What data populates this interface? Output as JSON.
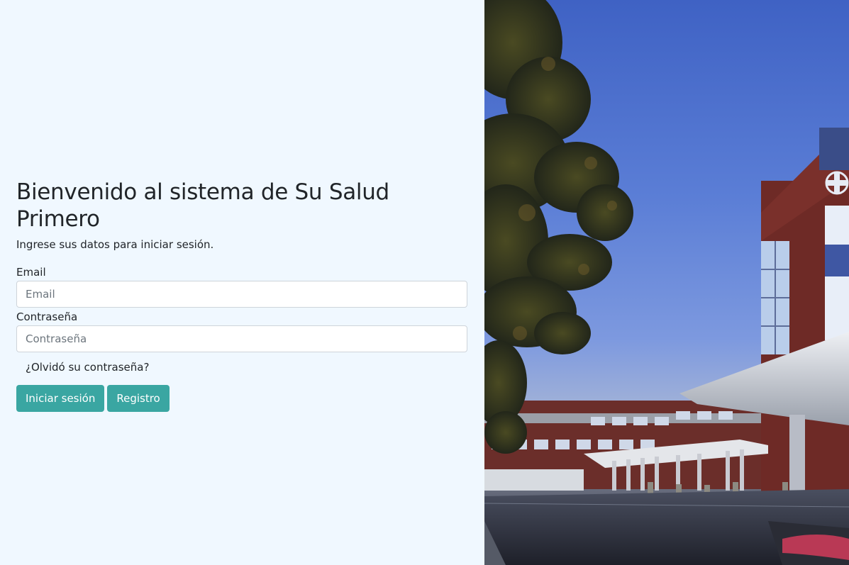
{
  "login": {
    "title": "Bienvenido al sistema de Su Salud Primero",
    "subtitle": "Ingrese sus datos para iniciar sesión.",
    "email_label": "Email",
    "email_placeholder": "Email",
    "email_value": "",
    "password_label": "Contraseña",
    "password_placeholder": "Contraseña",
    "password_value": "",
    "forgot_link": "¿Olvidó su contraseña?",
    "login_button": "Iniciar sesión",
    "register_button": "Registro"
  },
  "colors": {
    "left_background": "#f0f8ff",
    "button": "#3aa6a2",
    "text": "#212529"
  },
  "hero_image": {
    "subject": "hospital-building-at-dusk"
  }
}
